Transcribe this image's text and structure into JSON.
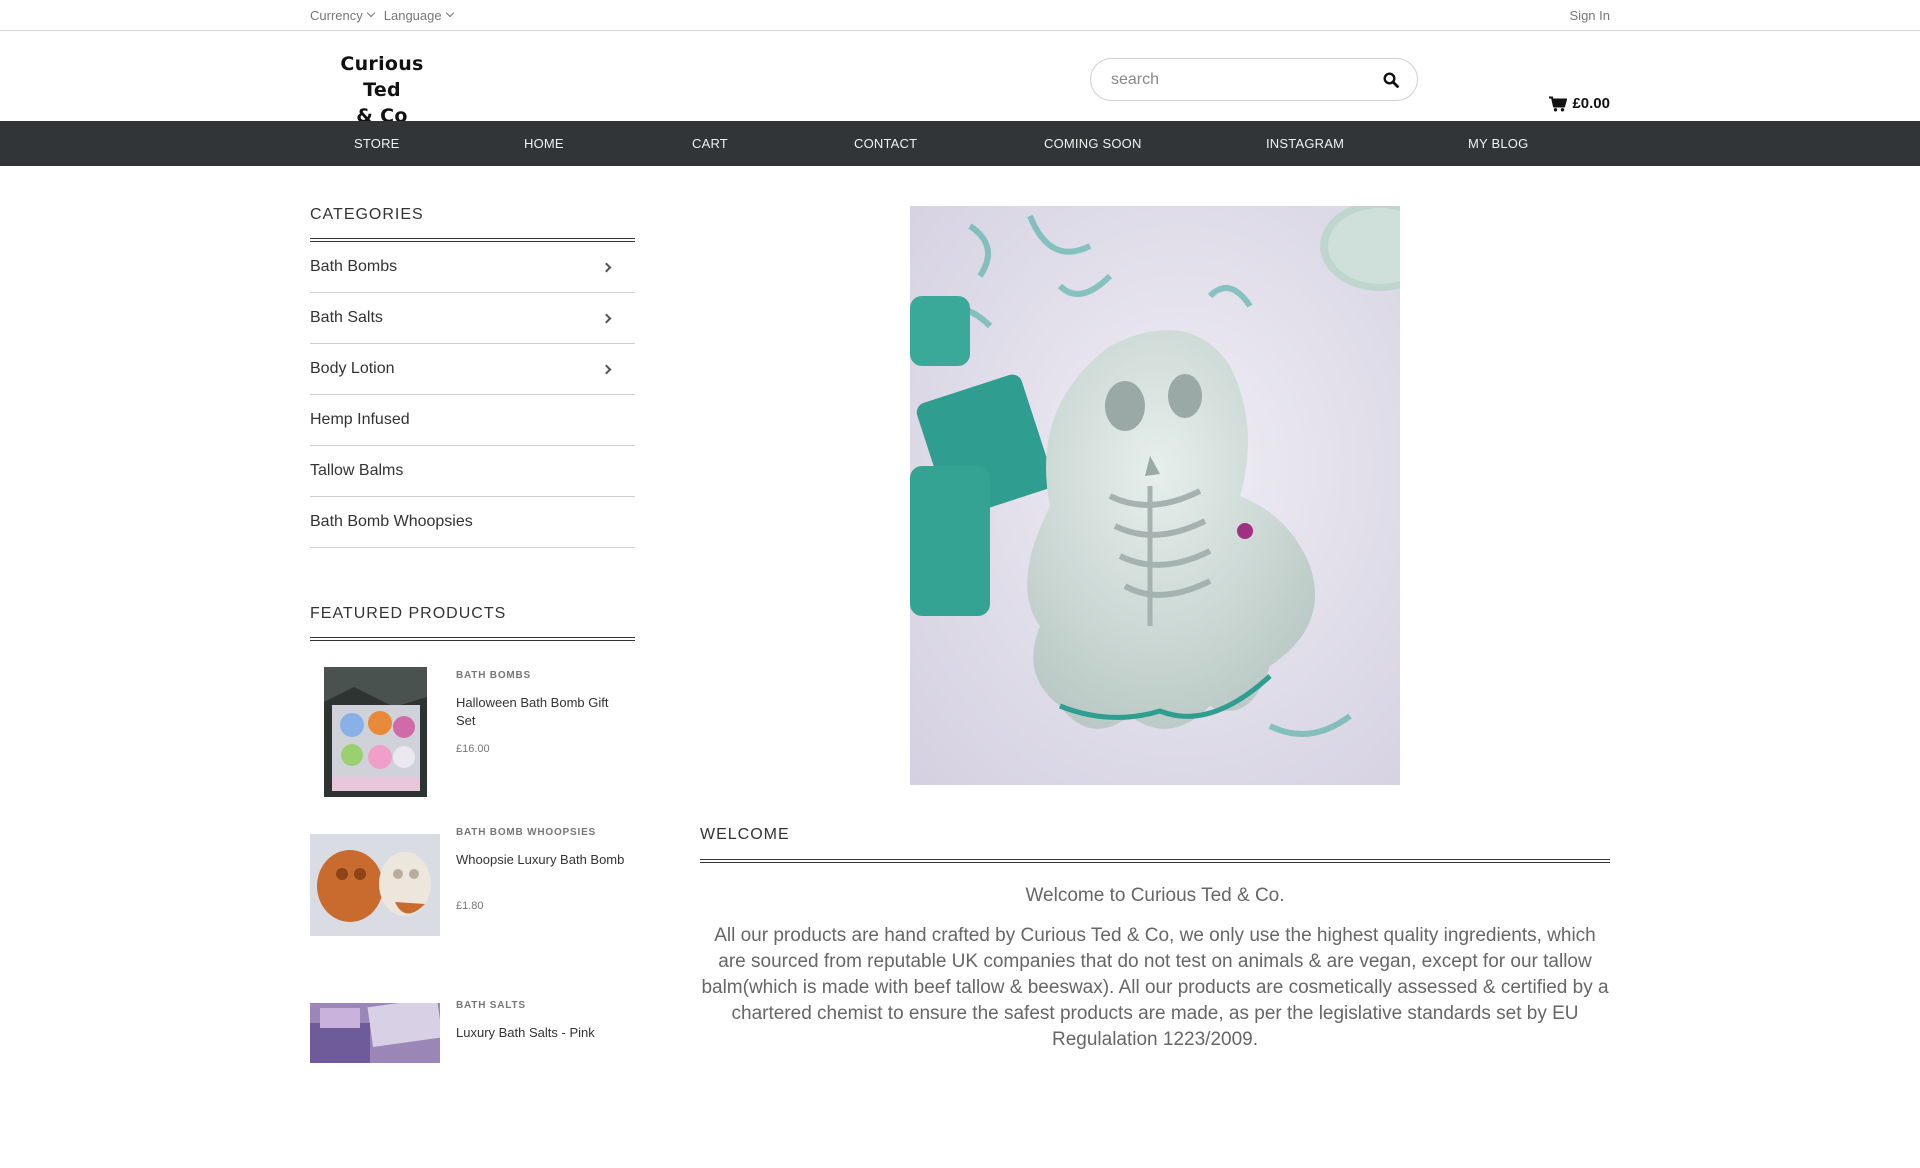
{
  "topbar": {
    "currency_label": "Currency",
    "language_label": "Language",
    "signin_label": "Sign In"
  },
  "header": {
    "logo_line1": "Curious Ted",
    "logo_line2": "& Co",
    "search_placeholder": "search",
    "cart_total": "£0.00"
  },
  "nav": {
    "items": [
      "STORE",
      "HOME",
      "CART",
      "CONTACT",
      "COMING SOON",
      "INSTAGRAM",
      "MY BLOG"
    ]
  },
  "sidebar": {
    "categories_title": "CATEGORIES",
    "categories": [
      {
        "label": "Bath Bombs",
        "has_arrow": true
      },
      {
        "label": "Bath Salts",
        "has_arrow": true
      },
      {
        "label": "Body Lotion",
        "has_arrow": true
      },
      {
        "label": "Hemp Infused",
        "has_arrow": false
      },
      {
        "label": "Tallow Balms",
        "has_arrow": false
      },
      {
        "label": "Bath Bomb Whoopsies",
        "has_arrow": false
      }
    ],
    "featured_title": "FEATURED PRODUCTS",
    "featured": [
      {
        "category": "BATH BOMBS",
        "name": "Halloween Bath Bomb Gift Set",
        "price": "£16.00"
      },
      {
        "category": "BATH BOMB WHOOPSIES",
        "name": "Whoopsie Luxury Bath Bomb",
        "price": "£1.80"
      },
      {
        "category": "BATH SALTS",
        "name": "Luxury Bath Salts - Pink",
        "price": ""
      }
    ]
  },
  "main": {
    "welcome_heading": "WELCOME",
    "welcome_title": "Welcome to Curious Ted & Co.",
    "welcome_text": "All our products are hand crafted by Curious Ted & Co, we only use the highest quality ingredients, which are sourced from reputable UK  companies that do not test on animals & are vegan, except for our tallow balm(which is made with beef tallow & beeswax). All our products are cosmetically assessed & certified by a chartered chemist to ensure the safest products are made, as per the legislative standards set by EU Regulalation 1223/2009."
  },
  "colors": {
    "nav_bg": "#323537",
    "text": "#333333",
    "muted": "#777777",
    "accent_teal": "#3aa99a"
  }
}
